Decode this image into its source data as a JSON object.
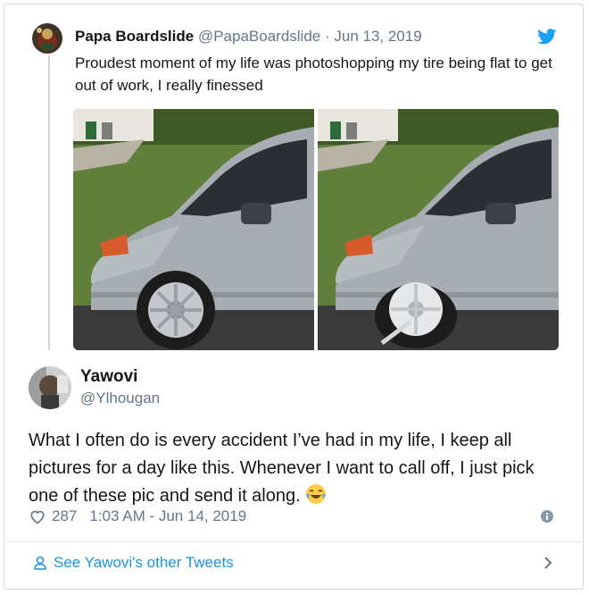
{
  "quoted_tweet": {
    "display_name": "Papa Boardslide",
    "handle": "@PapaBoardslide",
    "separator": " · ",
    "date": "Jun 13, 2019",
    "text": "Proudest moment of my life was photoshopping my tire being flat to get out of work, I really finessed",
    "icon": "twitter-bird-icon"
  },
  "reply_tweet": {
    "display_name": "Yawovi",
    "handle": "@Ylhougan",
    "text": "What I often do is every accident I’ve had in my life, I keep all pictures for a day like this. Whenever I want to call off, I just pick one of these pic and send it along.",
    "emoji": "face-with-tears-of-joy",
    "likes": "287",
    "timestamp": "1:03 AM - Jun 14, 2019"
  },
  "footer": {
    "see_more": "See Yawovi's other Tweets"
  },
  "colors": {
    "link": "#1b95e0",
    "muted": "#657786",
    "text": "#14171a",
    "border": "#cfd9de"
  }
}
